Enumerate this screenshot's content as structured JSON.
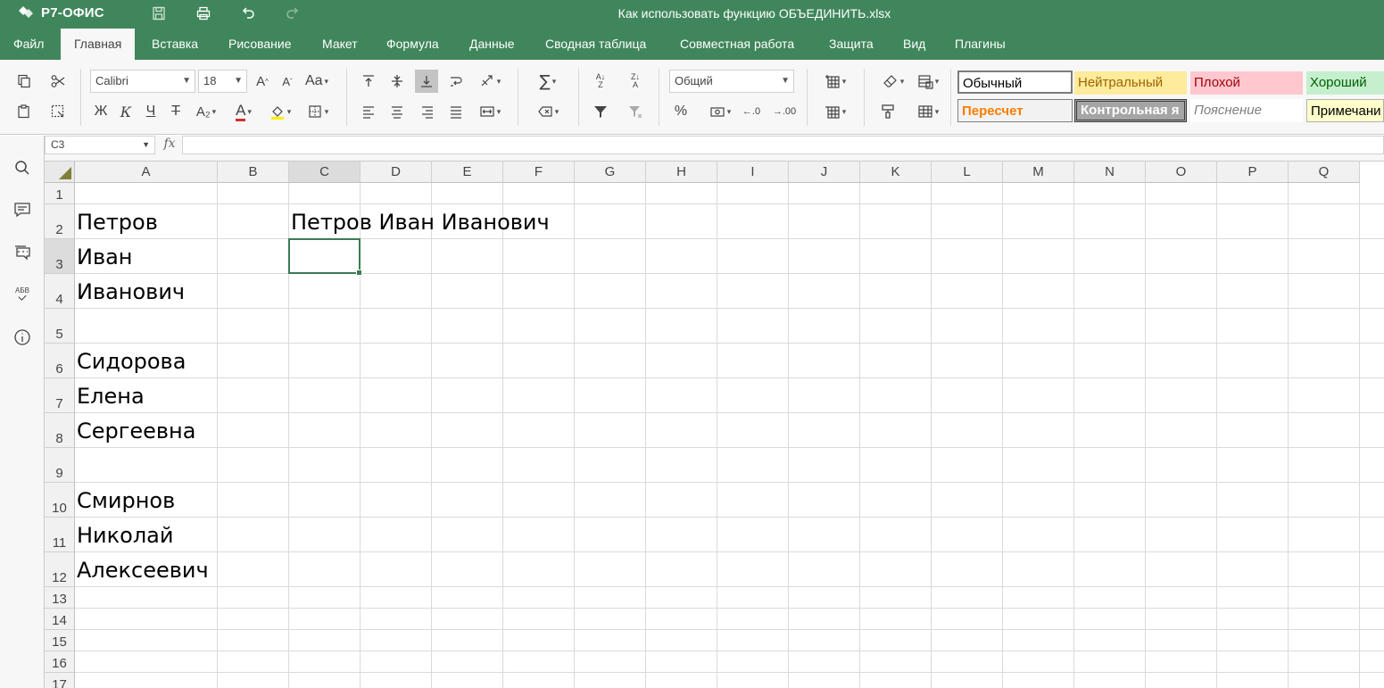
{
  "app": {
    "logo_text": "Р7-ОФИС",
    "document_title": "Как использовать функцию ОБЪЕДИНИТЬ.xlsx"
  },
  "menu": {
    "items": [
      "Файл",
      "Главная",
      "Вставка",
      "Рисование",
      "Макет",
      "Формула",
      "Данные",
      "Сводная таблица",
      "Совместная работа",
      "Защита",
      "Вид",
      "Плагины"
    ],
    "active": "Главная"
  },
  "ribbon": {
    "font_name": "Calibri",
    "font_size": "18",
    "number_format": "Общий",
    "bold": "Ж",
    "italic": "К",
    "underline": "Ч",
    "strike": "Т",
    "subscript": "A₂",
    "font_color_letter": "A",
    "increase_font": "A",
    "decrease_font": "A",
    "change_case": "Aa",
    "percent": "%",
    "dec_decrease": ".0",
    "dec_increase": ".00",
    "accent_red": "#d42d2d",
    "accent_yellow": "#ffef00",
    "cell_styles": [
      {
        "label": "Обычный"
      },
      {
        "label": "Нейтральный"
      },
      {
        "label": "Плохой"
      },
      {
        "label": "Хороший"
      },
      {
        "label": "Пересчет"
      },
      {
        "label": "Контрольная я"
      },
      {
        "label": "Пояснение"
      },
      {
        "label": "Примечани"
      }
    ]
  },
  "formula_bar": {
    "name_box": "C3",
    "fx": "fx",
    "formula": ""
  },
  "left_panel": {
    "icons": [
      "search-icon",
      "comments-icon",
      "chat-icon",
      "spellcheck-icon",
      "info-icon"
    ],
    "spellcheck_label": "АБВ"
  },
  "sheet": {
    "columns": [
      "A",
      "B",
      "C",
      "D",
      "E",
      "F",
      "G",
      "H",
      "I",
      "J",
      "K",
      "L",
      "M",
      "N",
      "O",
      "P",
      "Q"
    ],
    "rows": [
      "1",
      "2",
      "3",
      "4",
      "5",
      "6",
      "7",
      "8",
      "9",
      "10",
      "11",
      "12",
      "13",
      "14",
      "15",
      "16",
      "17"
    ],
    "selected_cell": "C3",
    "cells": {
      "A2": "Петров",
      "A3": "Иван",
      "A4": "Иванович",
      "A6": "Сидорова",
      "A7": "Елена",
      "A8": "Сергеевна",
      "A10": "Смирнов",
      "A11": "Николай",
      "A12": "Алексеевич",
      "C2": "Петров Иван Иванович"
    }
  }
}
